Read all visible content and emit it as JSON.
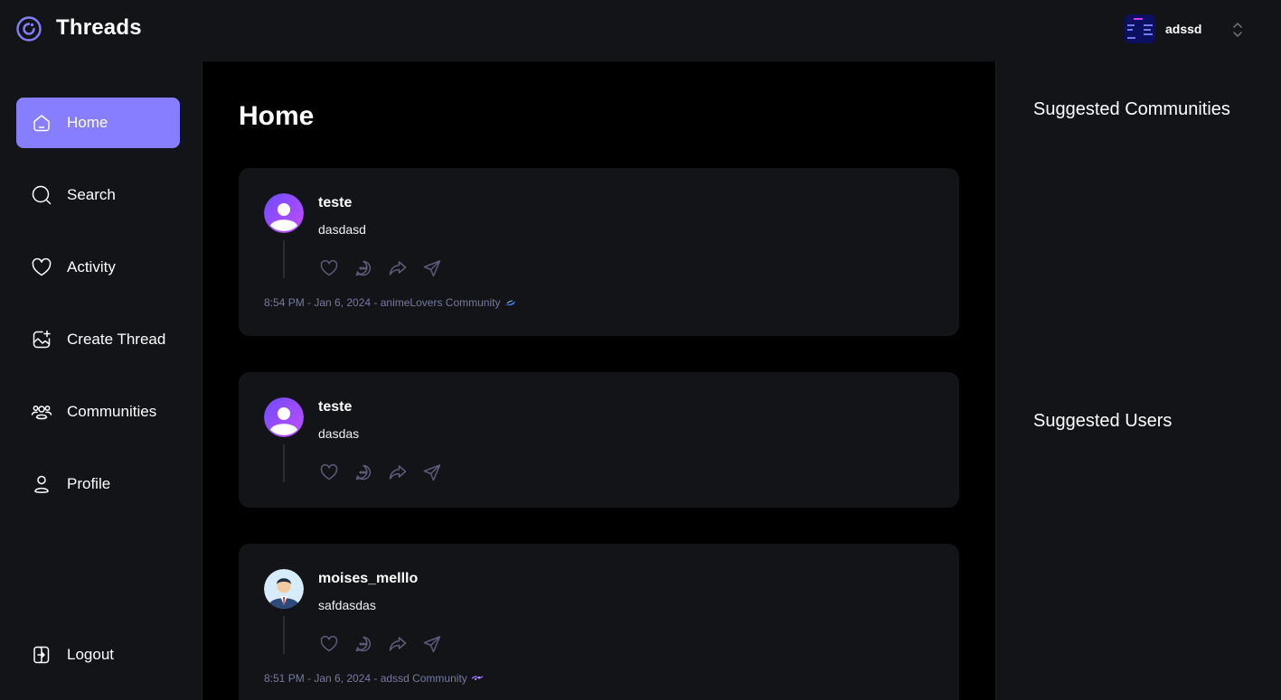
{
  "app": {
    "brand": "Threads"
  },
  "org_switcher": {
    "name": "adssd"
  },
  "nav": {
    "items": [
      {
        "label": "Home",
        "icon": "home-icon",
        "active": true
      },
      {
        "label": "Search",
        "icon": "search-icon",
        "active": false
      },
      {
        "label": "Activity",
        "icon": "heart-icon",
        "active": false
      },
      {
        "label": "Create Thread",
        "icon": "create-image-icon",
        "active": false
      },
      {
        "label": "Communities",
        "icon": "users-icon",
        "active": false
      },
      {
        "label": "Profile",
        "icon": "user-icon",
        "active": false
      }
    ],
    "logout": "Logout"
  },
  "main": {
    "title": "Home",
    "threads": [
      {
        "author": "teste",
        "text": "dasdasd",
        "meta": "8:54 PM - Jan 6, 2024 - animeLovers Community",
        "avatar": "default-user-avatar"
      },
      {
        "author": "teste",
        "text": "dasdas",
        "meta": "",
        "avatar": "default-user-avatar"
      },
      {
        "author": "moises_melllo",
        "text": "safdasdas",
        "meta": "8:51 PM - Jan 6, 2024 - adssd Community",
        "avatar": "businessman-avatar"
      }
    ]
  },
  "rightbar": {
    "suggested_communities": "Suggested Communities",
    "suggested_users": "Suggested Users"
  },
  "colors": {
    "accent": "#877eff",
    "panel": "#121417",
    "background": "#000000",
    "muted": "#7878a3"
  }
}
